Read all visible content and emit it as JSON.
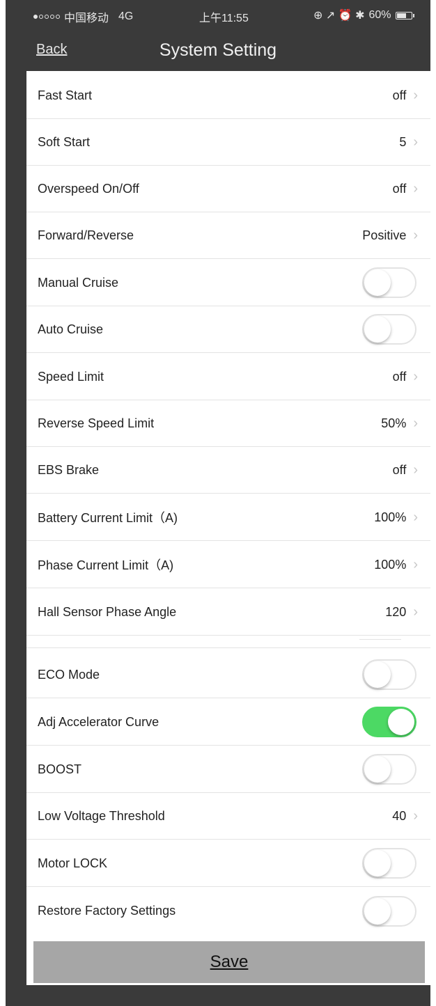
{
  "status_bar": {
    "carrier": "中国移动",
    "network": "4G",
    "time": "上午11:55",
    "icons": "⊕ ↗ ⏰ ✱",
    "battery": "60%"
  },
  "nav": {
    "back_label": "Back",
    "title": "System Setting"
  },
  "settings": {
    "fast_start": {
      "label": "Fast Start",
      "value": "off"
    },
    "soft_start": {
      "label": "Soft Start",
      "value": "5"
    },
    "overspeed": {
      "label": "Overspeed On/Off",
      "value": "off"
    },
    "forward_reverse": {
      "label": "Forward/Reverse",
      "value": "Positive"
    },
    "manual_cruise": {
      "label": "Manual Cruise",
      "on": false
    },
    "auto_cruise": {
      "label": "Auto Cruise",
      "on": false
    },
    "speed_limit": {
      "label": "Speed Limit",
      "value": "off"
    },
    "reverse_speed_limit": {
      "label": "Reverse Speed Limit",
      "value": "50%"
    },
    "ebs_brake": {
      "label": "EBS Brake",
      "value": "off"
    },
    "battery_current_limit": {
      "label": "Battery Current Limit（A)",
      "value": "100%"
    },
    "phase_current_limit": {
      "label": "Phase Current Limit（A)",
      "value": "100%"
    },
    "hall_sensor_phase_angle": {
      "label": "Hall Sensor Phase Angle",
      "value": "120"
    },
    "eco_mode": {
      "label": "ECO Mode",
      "on": false
    },
    "adj_accelerator_curve": {
      "label": "Adj Accelerator Curve",
      "on": true
    },
    "boost": {
      "label": "BOOST",
      "on": false
    },
    "low_voltage_threshold": {
      "label": "Low Voltage Threshold",
      "value": "40"
    },
    "motor_lock": {
      "label": "Motor LOCK",
      "on": false
    },
    "restore_factory_settings": {
      "label": "Restore Factory Settings",
      "on": false
    }
  },
  "save_label": "Save",
  "colors": {
    "toggle_on": "#4cd964",
    "background": "#3a3a3a",
    "save_button": "#a6a6a6"
  }
}
